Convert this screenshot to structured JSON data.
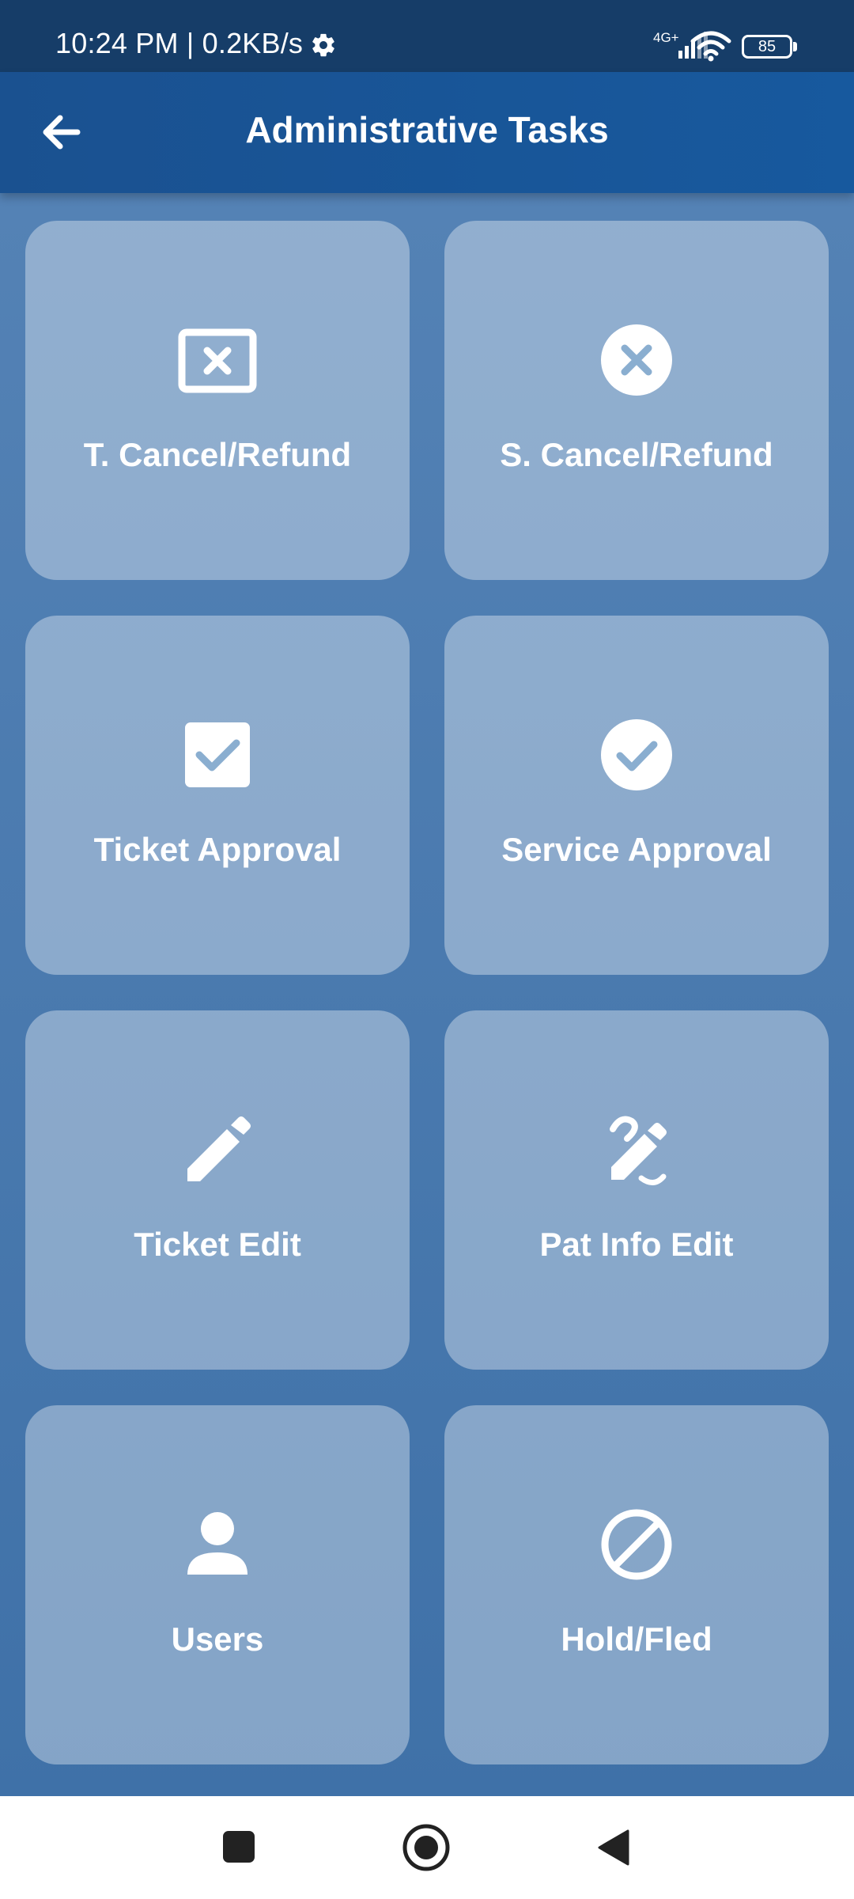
{
  "status_bar": {
    "time_speed": "10:24 PM | 0.2KB/s",
    "network": "4G+",
    "battery": "85"
  },
  "app_bar": {
    "title": "Administrative Tasks",
    "back_icon": "arrow-left-icon"
  },
  "tiles": [
    {
      "label": "T. Cancel/Refund",
      "icon": "square-x-icon"
    },
    {
      "label": "S. Cancel/Refund",
      "icon": "circle-x-icon"
    },
    {
      "label": "Ticket Approval",
      "icon": "checkbox-checked-icon"
    },
    {
      "label": "Service Approval",
      "icon": "circle-check-icon"
    },
    {
      "label": "Ticket Edit",
      "icon": "pencil-icon"
    },
    {
      "label": "Pat Info Edit",
      "icon": "signature-pen-icon"
    },
    {
      "label": "Users",
      "icon": "user-icon"
    },
    {
      "label": "Hold/Fled",
      "icon": "prohibited-icon"
    }
  ],
  "nav_bar": {
    "recents": "recents-square-icon",
    "home": "home-circle-icon",
    "back": "back-triangle-icon"
  },
  "colors": {
    "status_bar": "#163d68",
    "app_bar": "#1a5190",
    "background": "#4a79ae",
    "tile": "rgba(255,255,255,0.36)",
    "icon_accent": "#8aaed0"
  }
}
